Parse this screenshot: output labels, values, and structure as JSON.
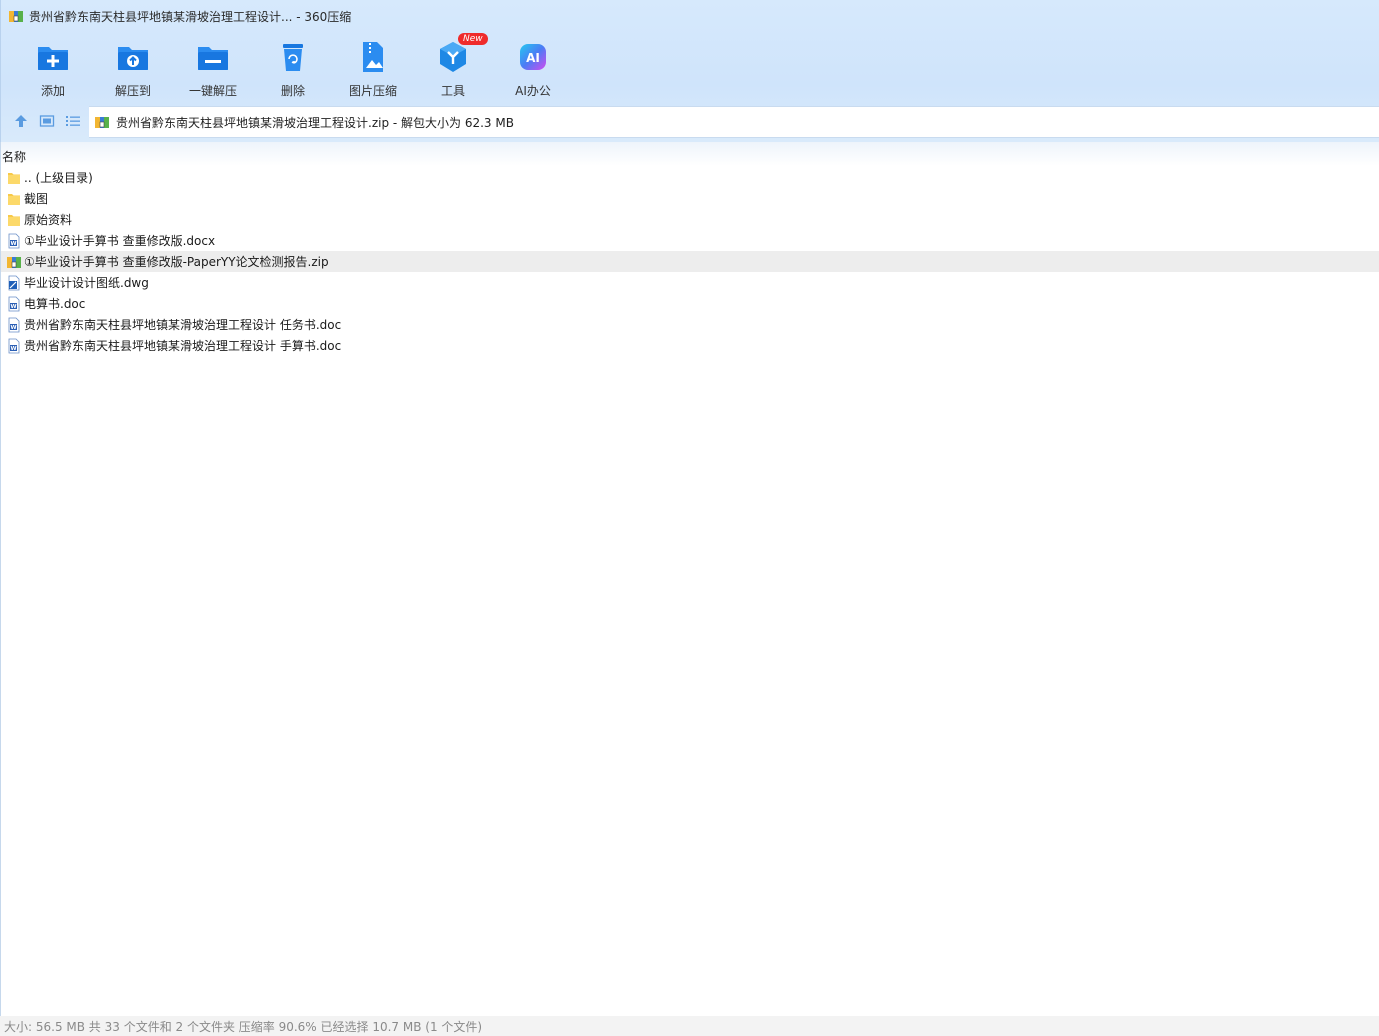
{
  "window": {
    "title": "贵州省黔东南天柱县坪地镇某滑坡治理工程设计... - 360压缩"
  },
  "toolbar": {
    "items": [
      {
        "label": "添加",
        "icon": "add-folder-icon"
      },
      {
        "label": "解压到",
        "icon": "extract-to-icon"
      },
      {
        "label": "一键解压",
        "icon": "one-click-extract-icon"
      },
      {
        "label": "删除",
        "icon": "trash-icon"
      },
      {
        "label": "图片压缩",
        "icon": "image-compress-icon"
      },
      {
        "label": "工具",
        "icon": "tools-cube-icon",
        "badge": "New"
      },
      {
        "label": "AI办公",
        "icon": "ai-office-icon"
      }
    ]
  },
  "nav": {
    "address": "贵州省黔东南天柱县坪地镇某滑坡治理工程设计.zip - 解包大小为 62.3 MB"
  },
  "list": {
    "column_name": "名称",
    "files": [
      {
        "name": ".. (上级目录)",
        "type": "folder-up"
      },
      {
        "name": "截图",
        "type": "folder"
      },
      {
        "name": "原始资料",
        "type": "folder"
      },
      {
        "name": "①毕业设计手算书 查重修改版.docx",
        "type": "word"
      },
      {
        "name": "①毕业设计手算书 查重修改版-PaperYY论文检测报告.zip",
        "type": "zip",
        "selected": true
      },
      {
        "name": "毕业设计设计图纸.dwg",
        "type": "dwg"
      },
      {
        "name": "电算书.doc",
        "type": "word"
      },
      {
        "name": "贵州省黔东南天柱县坪地镇某滑坡治理工程设计 任务书.doc",
        "type": "word"
      },
      {
        "name": "贵州省黔东南天柱县坪地镇某滑坡治理工程设计 手算书.doc",
        "type": "word"
      }
    ]
  },
  "status": {
    "text": "大小: 56.5 MB 共 33 个文件和 2 个文件夹 压缩率 90.6% 已经选择 10.7 MB (1 个文件)"
  },
  "colors": {
    "accent": "#1e88e5",
    "header_bg": "#d6e9fc",
    "selected_row": "#ededed",
    "badge_red": "#ef2b2b"
  }
}
